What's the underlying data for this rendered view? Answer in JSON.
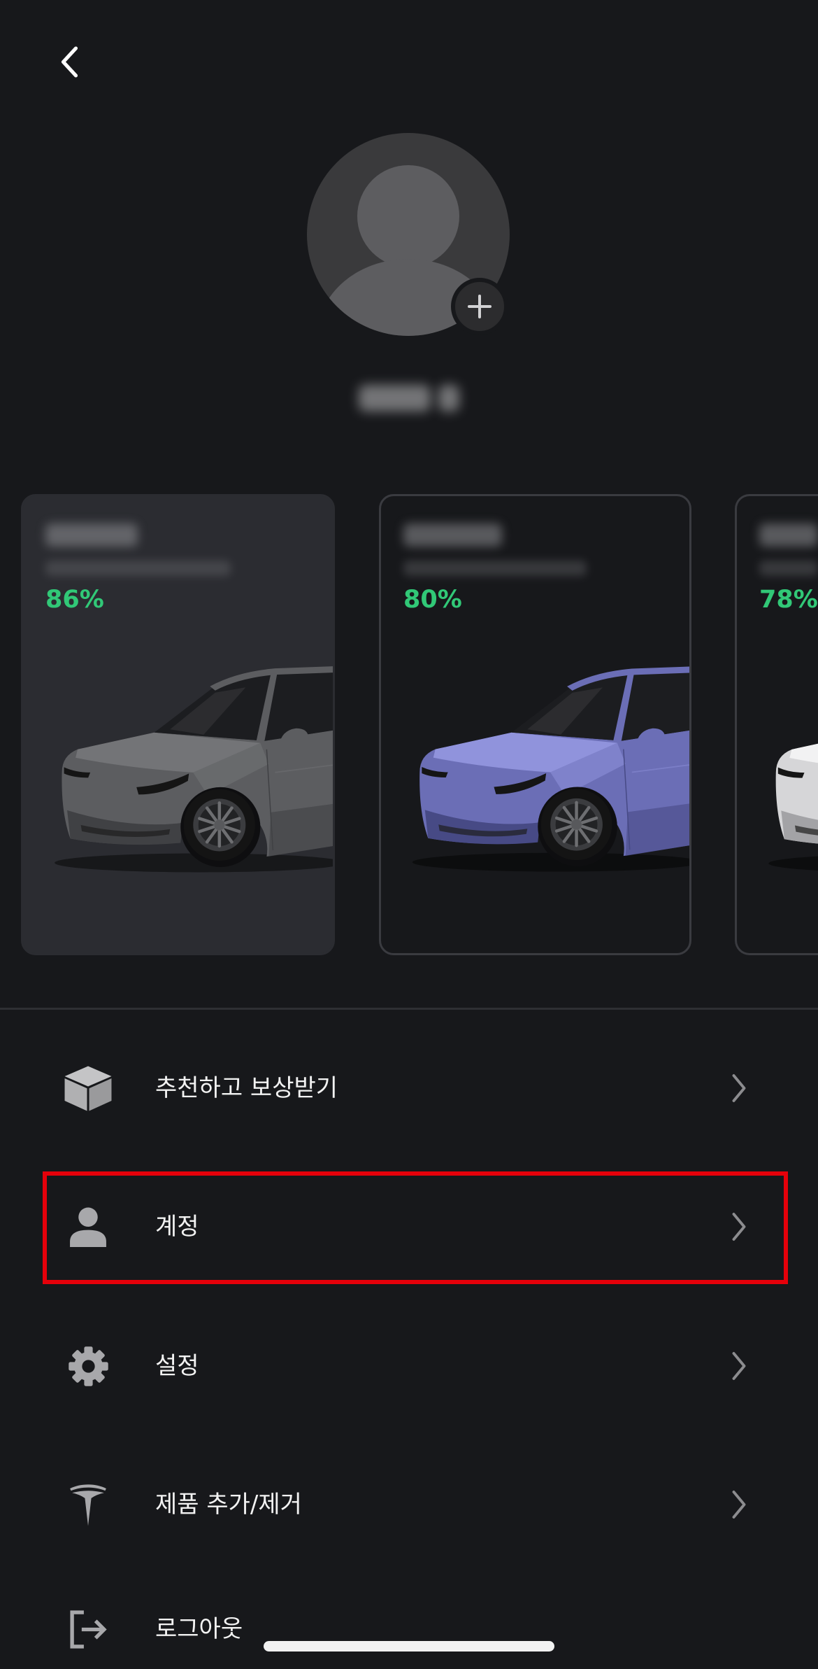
{
  "header": {
    "back_icon": "chevron-left-icon"
  },
  "profile": {
    "avatar_icon": "person-silhouette-icon",
    "add_photo_icon": "plus-icon"
  },
  "vehicles": [
    {
      "battery_level": "86%",
      "selected": true,
      "paint_color": "#5c5d60",
      "paint_light": "#737477",
      "paint_dark": "#404144"
    },
    {
      "battery_level": "80%",
      "selected": false,
      "paint_color": "#6b6eb6",
      "paint_light": "#9093dc",
      "paint_dark": "#474a85"
    },
    {
      "battery_level": "78%",
      "selected": false,
      "paint_color": "#d6d6d8",
      "paint_light": "#f2f2f3",
      "paint_dark": "#a3a3a6"
    }
  ],
  "menu": [
    {
      "label": "추천하고 보상받기",
      "icon": "cube-icon",
      "trailing_icon": "chevron-right-icon"
    },
    {
      "label": "계정",
      "icon": "person-icon",
      "trailing_icon": "chevron-right-icon",
      "highlighted": true
    },
    {
      "label": "설정",
      "icon": "gear-icon",
      "trailing_icon": "chevron-right-icon"
    },
    {
      "label": "제품 추가/제거",
      "icon": "tesla-logo-icon",
      "trailing_icon": "chevron-right-icon"
    },
    {
      "label": "로그아웃",
      "icon": "logout-icon"
    }
  ],
  "colors": {
    "background": "#17181b",
    "card_selected": "#2b2c31",
    "card_border": "#3a3b40",
    "battery_green": "#31c877",
    "text": "#f2f2f2",
    "icon": "#a8a8ab",
    "chevron": "#8c8c8f",
    "highlight": "#e5000a",
    "home_indicator": "#f2f2f2"
  }
}
